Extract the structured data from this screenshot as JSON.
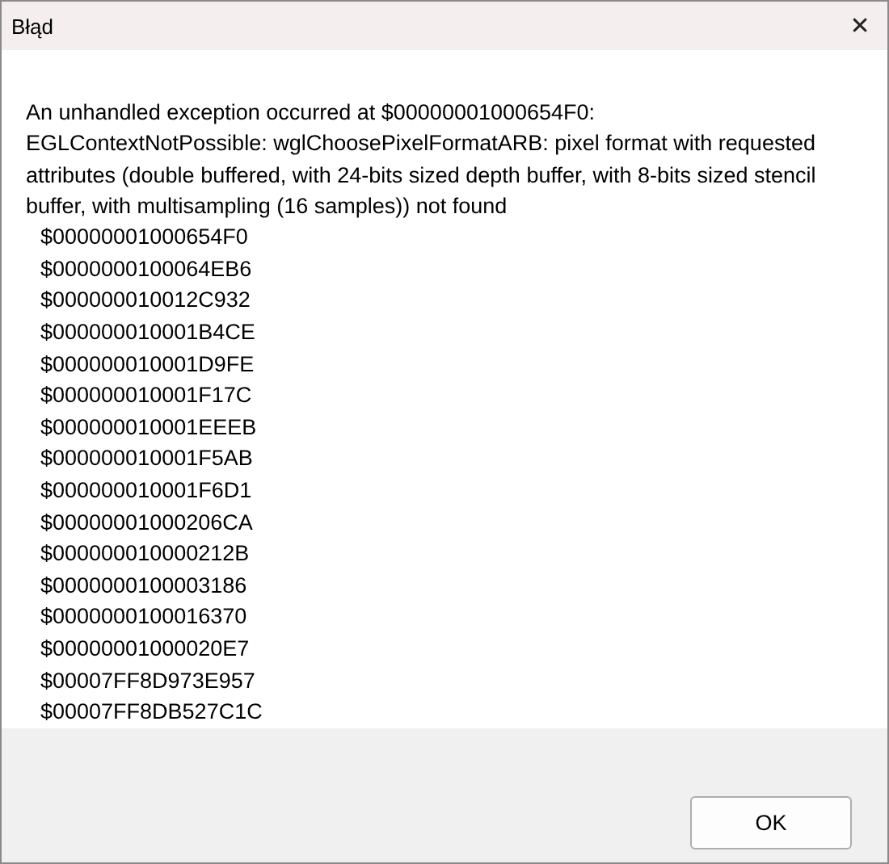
{
  "window": {
    "title": "Błąd",
    "close": "✕"
  },
  "message": "An unhandled exception occurred at $00000001000654F0:\nEGLContextNotPossible: wglChoosePixelFormatARB: pixel format with requested attributes (double buffered, with 24-bits sized depth buffer, with 8-bits sized stencil buffer, with multisampling (16 samples)) not found",
  "stack_trace": [
    "$00000001000654F0",
    "$0000000100064EB6",
    "$000000010012C932",
    "$000000010001B4CE",
    "$000000010001D9FE",
    "$000000010001F17C",
    "$000000010001EEEB",
    "$000000010001F5AB",
    "$000000010001F6D1",
    "$00000001000206CA",
    "$000000010000212B",
    "$0000000100003186",
    "$0000000100016370",
    "$00000001000020E7",
    "$00007FF8D973E957",
    "$00007FF8DB527C1C"
  ],
  "buttons": [
    "OK"
  ]
}
